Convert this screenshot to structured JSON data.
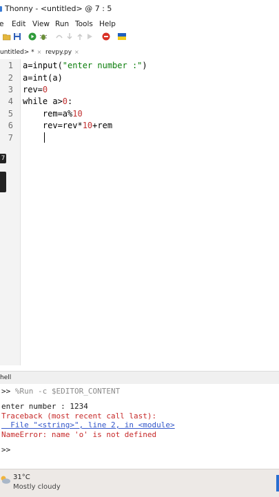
{
  "window": {
    "title": "Thonny  -  <untitled>  @  7 : 5"
  },
  "menu": [
    "e",
    "Edit",
    "View",
    "Run",
    "Tools",
    "Help"
  ],
  "toolbar_icons": [
    "new-file-icon",
    "save-icon",
    "run-icon",
    "debug-icon",
    "step-over-icon",
    "step-into-icon",
    "step-out-icon",
    "resume-icon",
    "stop-icon",
    "flag-icon"
  ],
  "tabs": [
    {
      "label": "untitled> *",
      "close": "×"
    },
    {
      "label": "revpy.py",
      "close": "×"
    }
  ],
  "editor": {
    "line_numbers": [
      "1",
      "2",
      "3",
      "4",
      "5",
      "6",
      "7"
    ],
    "lines": [
      {
        "a": "a=input(",
        "s": "\"enter number :\"",
        "b": ")"
      },
      {
        "a": "a=int(a)"
      },
      {
        "a": "rev=",
        "n": "0"
      },
      {
        "a": "while a>",
        "n": "0",
        "b": ":"
      },
      {
        "a": "    rem=a%",
        "n": "10"
      },
      {
        "a": "    rev=rev*",
        "n": "10",
        "b": "+rem"
      },
      {
        "a": ""
      }
    ],
    "side_markers": [
      "7",
      ""
    ]
  },
  "shell": {
    "title": "hell",
    "lines": [
      {
        "prompt": ">> ",
        "text": "%Run -c $EDITOR_CONTENT"
      },
      {
        "text": "enter number : 1234"
      },
      {
        "text": "Traceback (most recent call last):"
      },
      {
        "text": "  File \"<string>\", line 2, in <module>"
      },
      {
        "text": "NameError: name 'o' is not defined"
      },
      {
        "prompt": ">>"
      }
    ]
  },
  "taskbar": {
    "temperature": "31°C",
    "condition": "Mostly cloudy"
  }
}
